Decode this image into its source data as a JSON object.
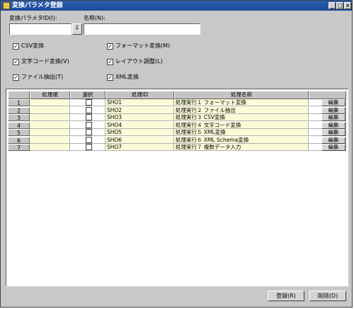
{
  "window": {
    "title": "変換パラメタ登録"
  },
  "form": {
    "id_label": "変換パラメタID(I):",
    "id_value": "",
    "name_label": "名称(N):",
    "name_value": ""
  },
  "options": [
    {
      "label": "CSV変換",
      "checked": true
    },
    {
      "label": "文字コード変換(V)",
      "checked": true
    },
    {
      "label": "ファイル抽出(T)",
      "checked": true
    },
    {
      "label": "フォーマット変換(M)",
      "checked": true
    },
    {
      "label": "レイアウト調整(L)",
      "checked": true
    },
    {
      "label": "XML変換",
      "checked": true
    }
  ],
  "table": {
    "headers": [
      "処理順",
      "選択",
      "処理ID",
      "処理名称"
    ],
    "edit_label": "編集",
    "rows": [
      {
        "no": "1",
        "id": "SHO1",
        "name": "処理実行１ フォーマット変換"
      },
      {
        "no": "2",
        "id": "SHO2",
        "name": "処理実行２ ファイル抽出"
      },
      {
        "no": "3",
        "id": "SHO3",
        "name": "処理実行３ CSV変換"
      },
      {
        "no": "4",
        "id": "SHO4",
        "name": "処理実行４ 文字コード変換"
      },
      {
        "no": "5",
        "id": "SHO5",
        "name": "処理実行５ XML変換"
      },
      {
        "no": "6",
        "id": "SHO6",
        "name": "処理実行６ XML Schema変換"
      },
      {
        "no": "7",
        "id": "SHO7",
        "name": "処理実行７ 複数データ入力"
      }
    ]
  },
  "buttons": {
    "register": "登録(R)",
    "delete": "削除(D)"
  }
}
